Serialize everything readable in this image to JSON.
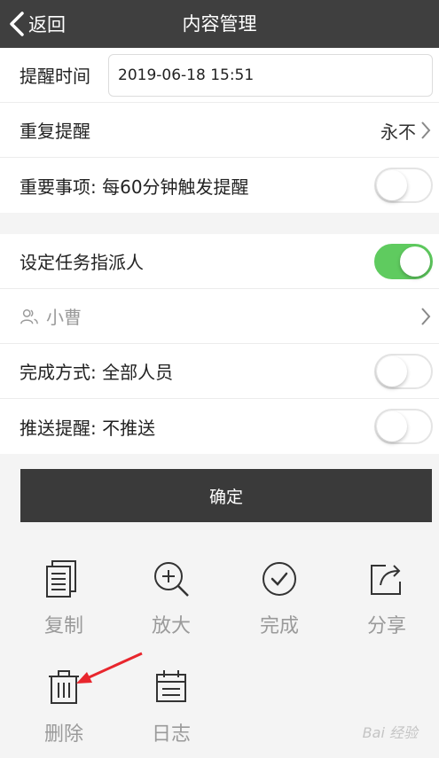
{
  "header": {
    "back_label": "返回",
    "title": "内容管理"
  },
  "reminder": {
    "time_label": "提醒时间",
    "time_value": "2019-06-18 15:51",
    "repeat_label": "重复提醒",
    "repeat_value": "永不",
    "important_label": "重要事项: 每60分钟触发提醒",
    "important_on": false
  },
  "assignment": {
    "set_assignee_label": "设定任务指派人",
    "set_assignee_on": true,
    "assignee_name": "小曹",
    "completion_label": "完成方式: 全部人员",
    "completion_on": false,
    "push_label": "推送提醒: 不推送",
    "push_on": false
  },
  "confirm_label": "确定",
  "actions": [
    {
      "label": "复制",
      "icon": "copy-icon"
    },
    {
      "label": "放大",
      "icon": "zoom-in-icon"
    },
    {
      "label": "完成",
      "icon": "check-circle-icon"
    },
    {
      "label": "分享",
      "icon": "share-icon"
    },
    {
      "label": "删除",
      "icon": "trash-icon"
    },
    {
      "label": "日志",
      "icon": "calendar-icon"
    }
  ],
  "colors": {
    "header_bg": "#3f3f3f",
    "toggle_on": "#5fcb5f",
    "button_bg": "#3a3a3a",
    "annotation_arrow": "#e8262d"
  },
  "watermark": "Bai 经验"
}
